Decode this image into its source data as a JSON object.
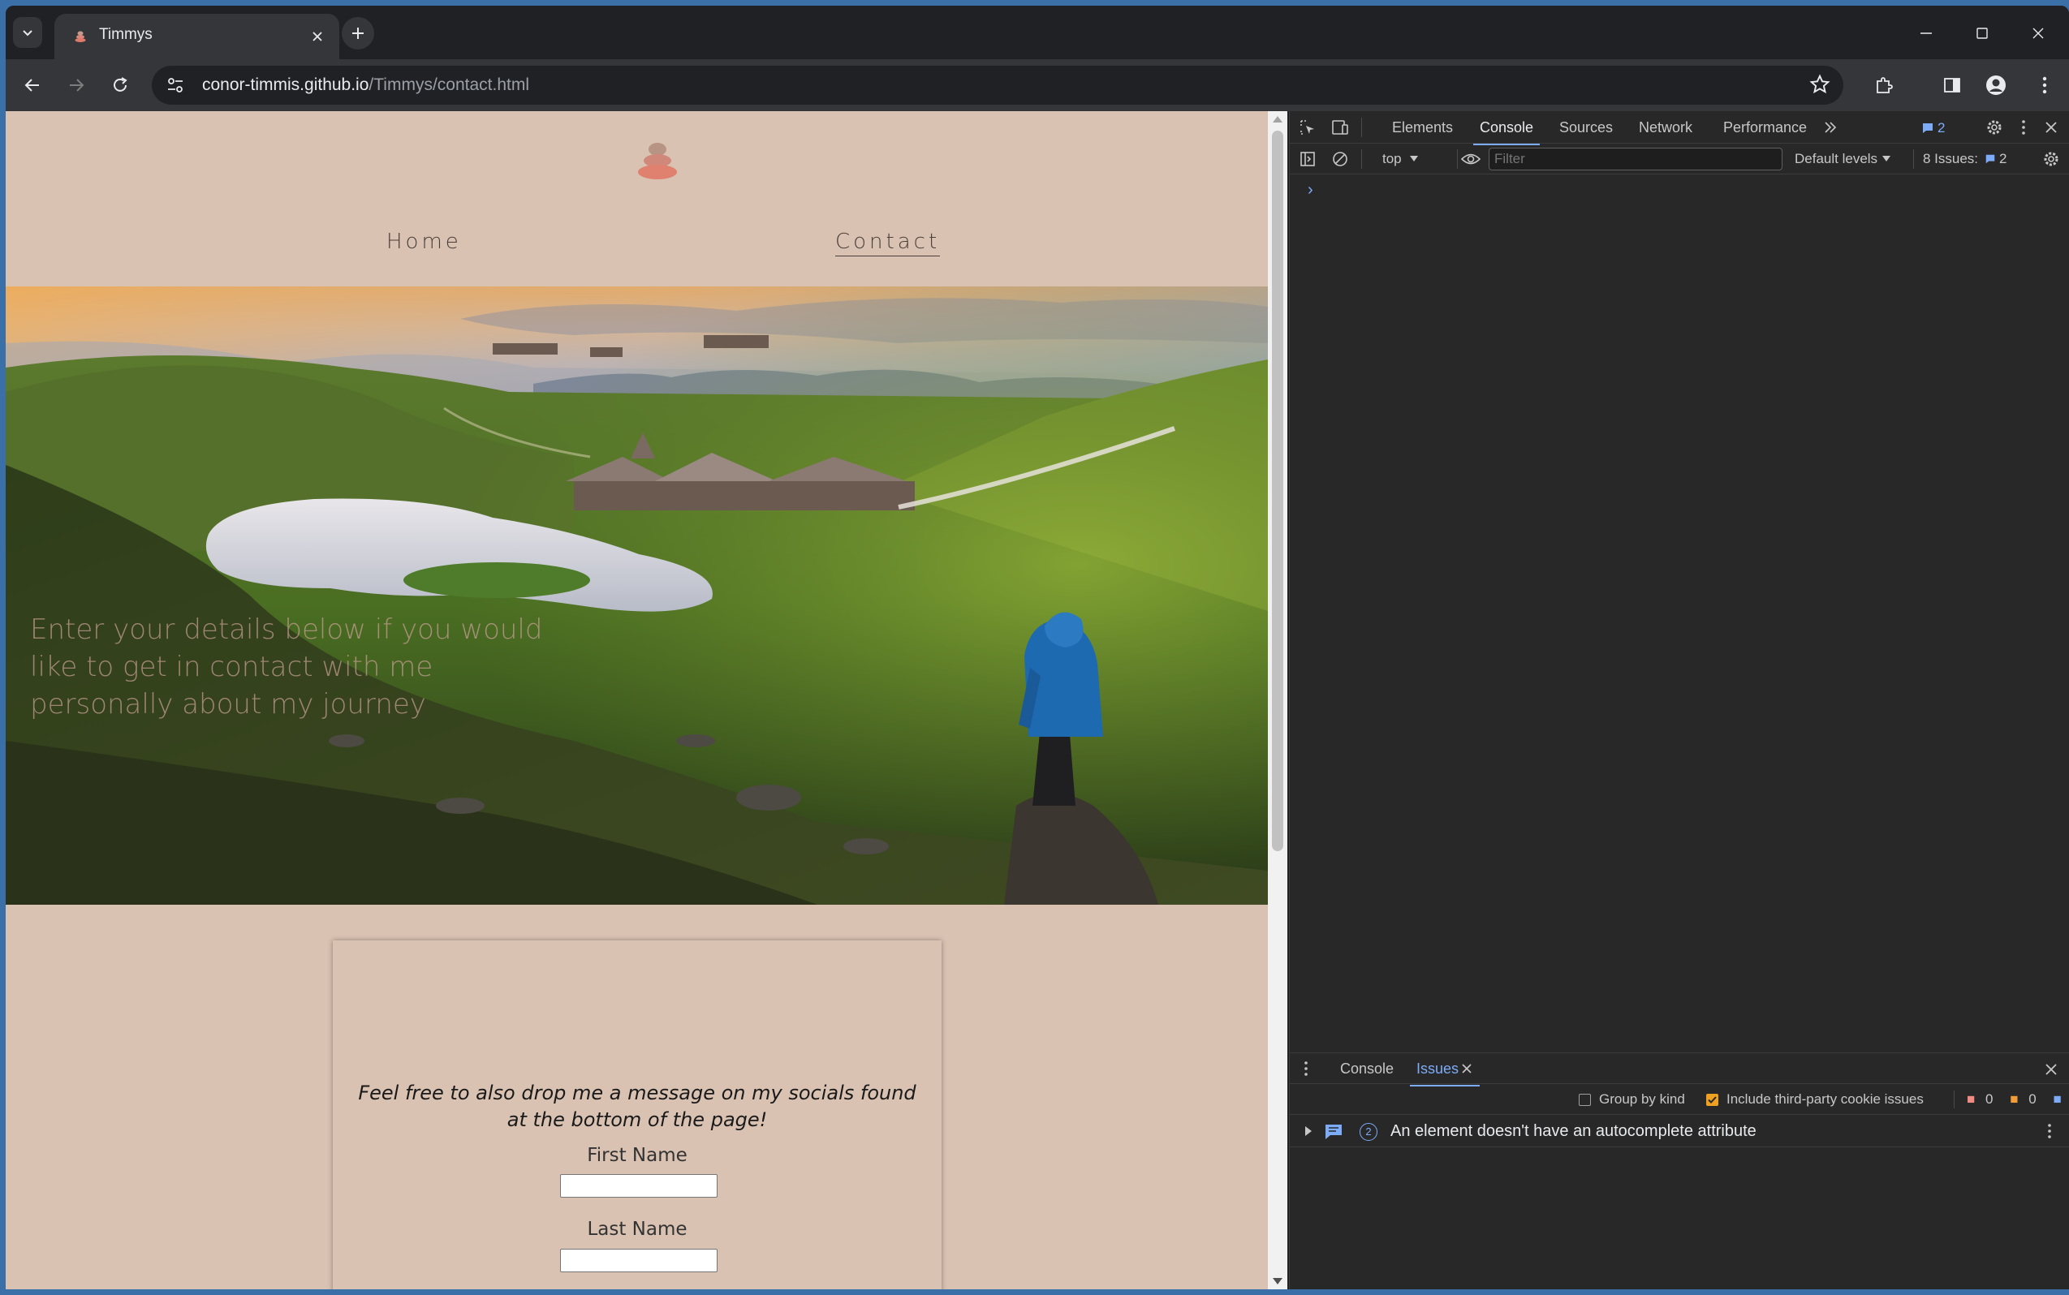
{
  "browser": {
    "tab": {
      "title": "Timmys"
    },
    "url": {
      "host": "conor-timmis.github.io",
      "path": "/Timmys/contact.html"
    }
  },
  "page": {
    "nav": {
      "home": "Home",
      "contact": "Contact"
    },
    "hero_text": "Enter your details below if you would like to get in contact with me personally about my journey",
    "card": {
      "note": "Feel free to also drop me a message on my socials found at the bottom of the page!",
      "first_name_label": "First Name",
      "last_name_label": "Last Name",
      "first_name_value": "",
      "last_name_value": ""
    }
  },
  "devtools": {
    "tabs": [
      "Elements",
      "Console",
      "Sources",
      "Network",
      "Performance"
    ],
    "active_tab": "Console",
    "message_badge": "2",
    "context": "top",
    "filter_placeholder": "Filter",
    "levels": "Default levels",
    "issues_label": "8 Issues:",
    "issues_count": "2",
    "prompt": "›",
    "drawer": {
      "tabs": [
        "Console",
        "Issues"
      ],
      "active_tab": "Issues",
      "group_by_kind": "Group by kind",
      "include_third_party": "Include third-party cookie issues",
      "group_by_kind_checked": false,
      "include_third_party_checked": true,
      "count_errors": "0",
      "count_warnings": "0",
      "count_info": "2",
      "issue": {
        "count": "2",
        "text": "An element doesn't have an autocomplete attribute"
      }
    }
  },
  "colors": {
    "page_bg": "#d9c2b2",
    "devtools_bg": "#282828",
    "accent": "#7cacf8"
  }
}
